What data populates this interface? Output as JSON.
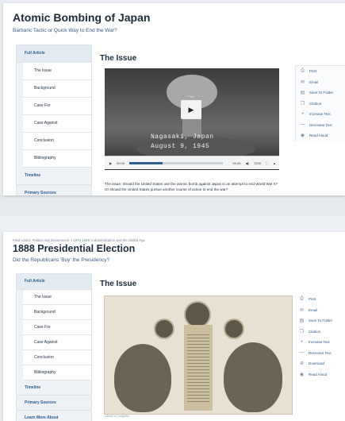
{
  "article1": {
    "title": "Atomic Bombing of Japan",
    "subtitle": "Barbaric Tactic or Quick Way to End the War?",
    "section_title": "The Issue",
    "sidebar": [
      "Full Article",
      "The Issue",
      "Background",
      "Case For",
      "Case Against",
      "Conclusion",
      "Bibliography",
      "Timeline",
      "Primary Sources"
    ],
    "tools": [
      {
        "icon": "print-icon",
        "glyph": "⎙",
        "label": "Print"
      },
      {
        "icon": "email-icon",
        "glyph": "✉",
        "label": "Email"
      },
      {
        "icon": "folder-icon",
        "glyph": "▤",
        "label": "Save To Folder"
      },
      {
        "icon": "citation-icon",
        "glyph": "❐",
        "label": "Citation"
      },
      {
        "icon": "increase-text-icon",
        "glyph": "+",
        "label": "Increase Text"
      },
      {
        "icon": "decrease-text-icon",
        "glyph": "—",
        "label": "Decrease Text"
      },
      {
        "icon": "read-aloud-icon",
        "glyph": "◉",
        "label": "Read Aloud"
      }
    ],
    "video": {
      "play_label": "Play",
      "caption_line1": "Nagasaki, Japan",
      "caption_line2": "August 9, 1945",
      "time_start": "00:00",
      "time_end": "00:44",
      "quality": "720X",
      "progress": 0.35
    },
    "body_text": "The issue: Should the United States use the atomic bomb against Japan in an attempt to end World War II? Or should the United States pursue another course of action to end the war?"
  },
  "article2": {
    "filed_under": "Filed Under: Politics and Government > 1870-1899: Industrialization and the Gilded Age",
    "title": "1888 Presidential Election",
    "subtitle": "Did the Republicans 'Buy' the Presidency?",
    "section_title": "The Issue",
    "sidebar": [
      "Full Article",
      "The Issue",
      "Background",
      "Case For",
      "Case Against",
      "Conclusion",
      "Bibliography",
      "Timeline",
      "Primary Sources",
      "Learn More About"
    ],
    "tools": [
      {
        "icon": "print-icon",
        "glyph": "⎙",
        "label": "Print"
      },
      {
        "icon": "email-icon",
        "glyph": "✉",
        "label": "Email"
      },
      {
        "icon": "folder-icon",
        "glyph": "▤",
        "label": "Save To Folder"
      },
      {
        "icon": "citation-icon",
        "glyph": "❐",
        "label": "Citation"
      },
      {
        "icon": "increase-text-icon",
        "glyph": "+",
        "label": "Increase Text"
      },
      {
        "icon": "decrease-text-icon",
        "glyph": "—",
        "label": "Decrease Text"
      },
      {
        "icon": "download-icon",
        "glyph": "⊕",
        "label": "Download"
      },
      {
        "icon": "read-aloud-icon",
        "glyph": "◉",
        "label": "Read Aloud"
      }
    ],
    "image_credit": "Library of Congress"
  }
}
